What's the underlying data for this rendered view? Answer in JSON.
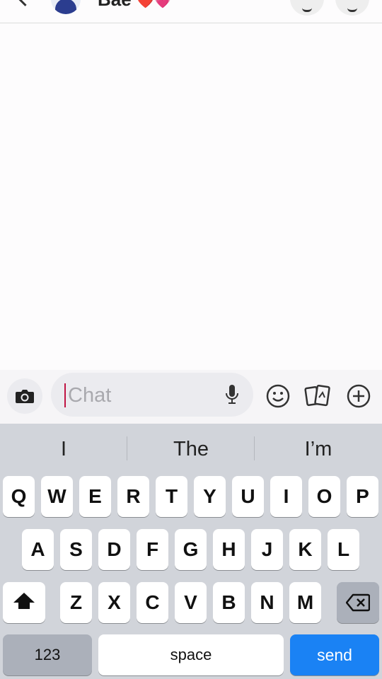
{
  "header": {
    "contact_name": "Bae",
    "contact_emoji": "❤️💗",
    "back_icon": "chevron-left-icon",
    "call_icon": "phone-icon",
    "video_icon": "video-camera-icon"
  },
  "input_bar": {
    "placeholder": "Chat",
    "camera_icon": "camera-icon",
    "mic_icon": "microphone-icon",
    "emoji_icon": "smiley-icon",
    "stickers_icon": "cards-icon",
    "plus_icon": "plus-circle-icon"
  },
  "keyboard": {
    "suggestions": [
      "I",
      "The",
      "I’m"
    ],
    "row1": [
      "Q",
      "W",
      "E",
      "R",
      "T",
      "Y",
      "U",
      "I",
      "O",
      "P"
    ],
    "row2": [
      "A",
      "S",
      "D",
      "F",
      "G",
      "H",
      "J",
      "K",
      "L"
    ],
    "row3": [
      "Z",
      "X",
      "C",
      "V",
      "B",
      "N",
      "M"
    ],
    "numbers_label": "123",
    "space_label": "space",
    "send_label": "send"
  },
  "colors": {
    "send_key": "#1a82f4",
    "caret": "#c01444",
    "keyboard_bg": "#d1d4da"
  }
}
